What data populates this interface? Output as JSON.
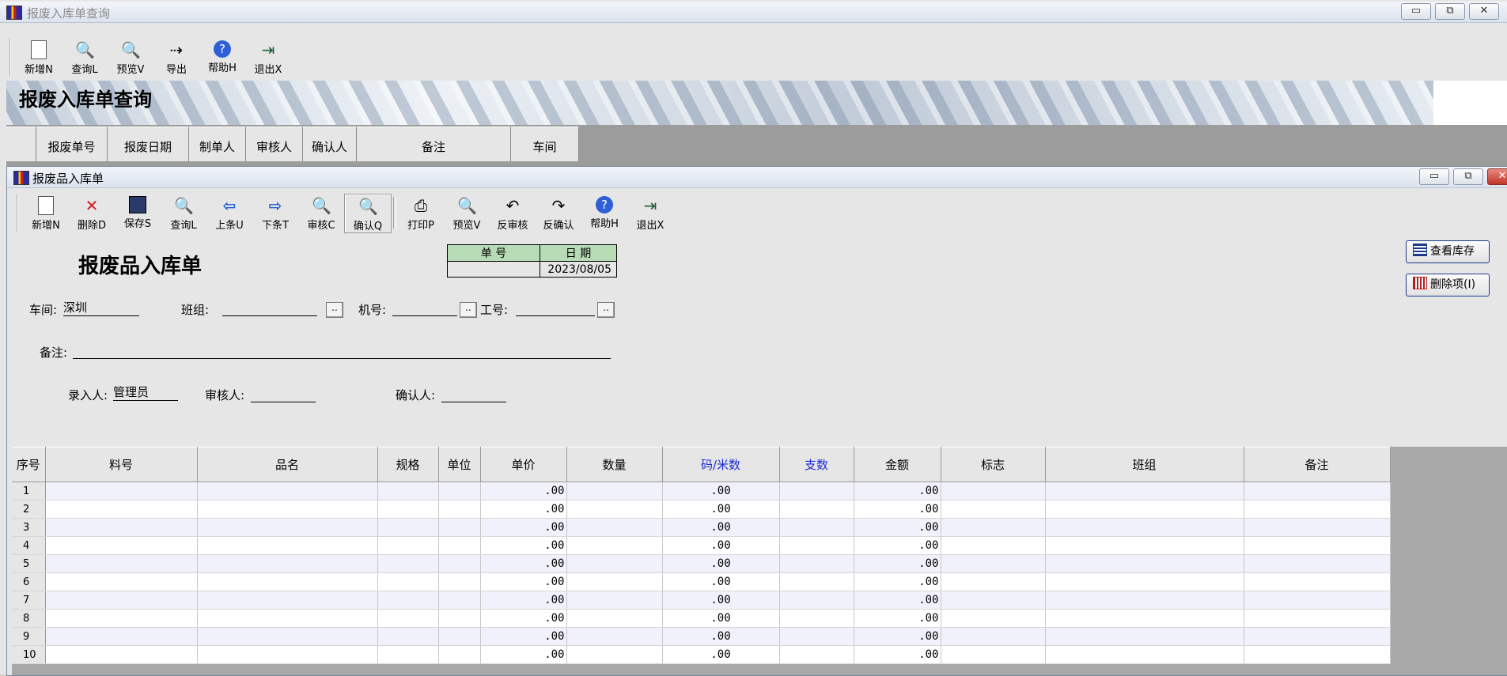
{
  "outer": {
    "title": "报废入库单查询",
    "toolbar": [
      {
        "label": "新增N",
        "icon": "new-doc-icon"
      },
      {
        "label": "查询L",
        "icon": "query-doc-icon"
      },
      {
        "label": "预览V",
        "icon": "preview-magnifier-icon"
      },
      {
        "label": "导出",
        "icon": "export-icon"
      },
      {
        "label": "帮助H",
        "icon": "help-icon"
      },
      {
        "label": "退出X",
        "icon": "exit-door-icon"
      }
    ],
    "banner_title": "报废入库单查询",
    "columns": [
      "报废单号",
      "报废日期",
      "制单人",
      "审核人",
      "确认人",
      "备注",
      "车间"
    ]
  },
  "inner": {
    "title": "报废品入库单",
    "toolbar": [
      {
        "label": "新增N",
        "icon": "new-doc-icon"
      },
      {
        "label": "删除D",
        "icon": "delete-x-icon"
      },
      {
        "label": "保存S",
        "icon": "save-disk-icon"
      },
      {
        "label": "查询L",
        "icon": "query-doc-icon"
      },
      {
        "label": "上条U",
        "icon": "arrow-left-icon"
      },
      {
        "label": "下条T",
        "icon": "arrow-right-icon"
      },
      {
        "label": "审核C",
        "icon": "audit-magnifier-icon"
      },
      {
        "label": "确认Q",
        "icon": "confirm-magnifier-icon"
      },
      {
        "label": "打印P",
        "icon": "printer-icon"
      },
      {
        "label": "预览V",
        "icon": "preview-magnifier-icon"
      },
      {
        "label": "反审核",
        "icon": "unaudit-icon"
      },
      {
        "label": "反确认",
        "icon": "unconfirm-icon"
      },
      {
        "label": "帮助H",
        "icon": "help-icon"
      },
      {
        "label": "退出X",
        "icon": "exit-door-icon"
      }
    ],
    "doc_title": "报废品入库单",
    "doc_no_label": "单  号",
    "date_label": "日  期",
    "doc_no_value": "",
    "date_value": "2023/08/05",
    "btn_view_stock": "查看库存",
    "btn_delete_item": "删除项(I)",
    "form": {
      "workshop_label": "车间:",
      "workshop_value": "深圳",
      "team_label": "班组:",
      "team_value": "",
      "machine_label": "机号:",
      "machine_value": "",
      "worker_label": "工号:",
      "worker_value": "",
      "remark_label": "备注:",
      "remark_value": "",
      "entered_label": "录入人:",
      "entered_value": "管理员",
      "auditor_label": "审核人:",
      "auditor_value": "",
      "confirmer_label": "确认人:",
      "confirmer_value": ""
    },
    "grid": {
      "columns": [
        "序号",
        "料号",
        "品名",
        "规格",
        "单位",
        "单价",
        "数量",
        "码/米数",
        "支数",
        "金额",
        "标志",
        "班组",
        "备注"
      ],
      "rows": [
        {
          "no": "1",
          "price": ".00",
          "meters": ".00",
          "amount": ".00"
        },
        {
          "no": "2",
          "price": ".00",
          "meters": ".00",
          "amount": ".00"
        },
        {
          "no": "3",
          "price": ".00",
          "meters": ".00",
          "amount": ".00"
        },
        {
          "no": "4",
          "price": ".00",
          "meters": ".00",
          "amount": ".00"
        },
        {
          "no": "5",
          "price": ".00",
          "meters": ".00",
          "amount": ".00"
        },
        {
          "no": "6",
          "price": ".00",
          "meters": ".00",
          "amount": ".00"
        },
        {
          "no": "7",
          "price": ".00",
          "meters": ".00",
          "amount": ".00"
        },
        {
          "no": "8",
          "price": ".00",
          "meters": ".00",
          "amount": ".00"
        },
        {
          "no": "9",
          "price": ".00",
          "meters": ".00",
          "amount": ".00"
        },
        {
          "no": "10",
          "price": ".00",
          "meters": ".00",
          "amount": ".00"
        }
      ]
    }
  },
  "colors": {
    "header_highlight": "#1c2bd6",
    "date_box_header": "#b7dcb5"
  }
}
